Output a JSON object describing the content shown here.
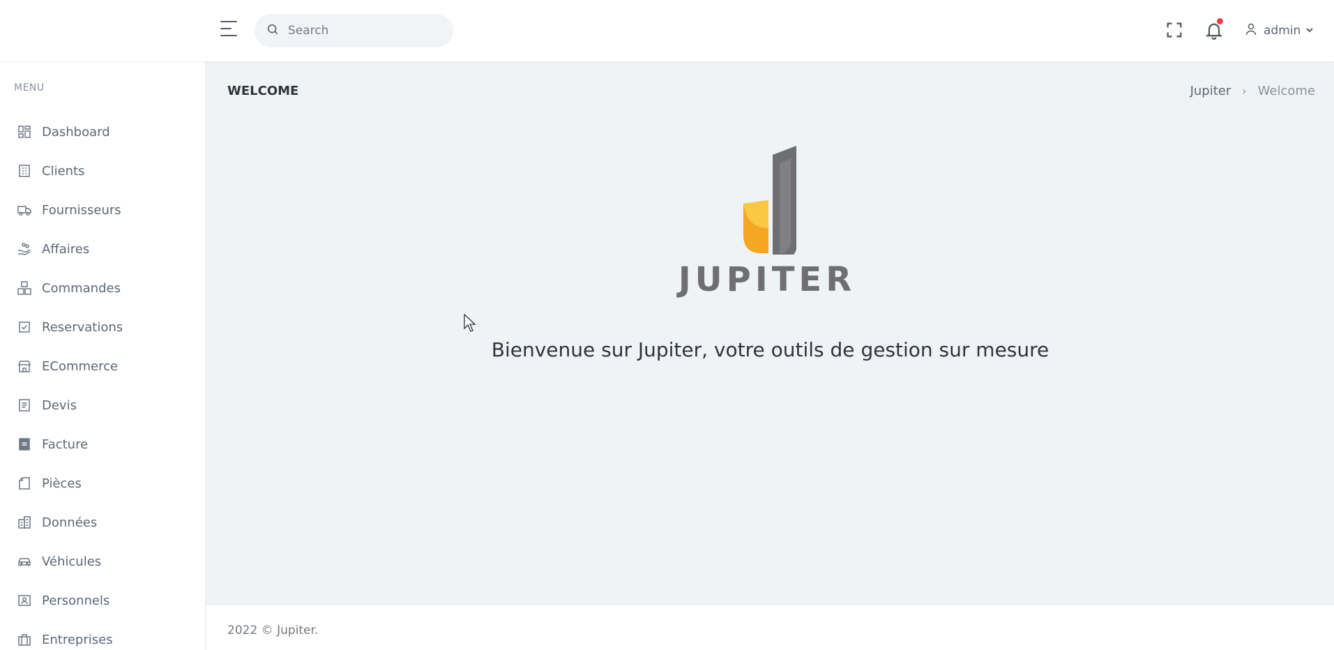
{
  "header": {
    "search_placeholder": "Search",
    "user_name": "admin"
  },
  "sidebar": {
    "menu_title": "MENU",
    "items": [
      {
        "label": "Dashboard",
        "icon": "dashboard-icon"
      },
      {
        "label": "Clients",
        "icon": "building-icon"
      },
      {
        "label": "Fournisseurs",
        "icon": "truck-icon"
      },
      {
        "label": "Affaires",
        "icon": "hand-coins-icon"
      },
      {
        "label": "Commandes",
        "icon": "boxes-icon"
      },
      {
        "label": "Reservations",
        "icon": "checkbox-icon"
      },
      {
        "label": "ECommerce",
        "icon": "store-icon"
      },
      {
        "label": "Devis",
        "icon": "document-icon"
      },
      {
        "label": "Facture",
        "icon": "invoice-icon"
      },
      {
        "label": "Pièces",
        "icon": "file-icon"
      },
      {
        "label": "Données",
        "icon": "database-building-icon"
      },
      {
        "label": "Véhicules",
        "icon": "car-icon"
      },
      {
        "label": "Personnels",
        "icon": "id-card-icon"
      },
      {
        "label": "Entreprises",
        "icon": "briefcase-icon"
      }
    ]
  },
  "page": {
    "title": "WELCOME",
    "breadcrumb": {
      "parent": "Jupiter",
      "current": "Welcome"
    },
    "logo_text": "JUPITER",
    "welcome_message": "Bienvenue sur Jupiter, votre outils de gestion sur mesure"
  },
  "footer": {
    "text": "2022 © Jupiter."
  },
  "colors": {
    "notification_dot": "#ef3b4d",
    "logo_yellow": "#fbc844",
    "logo_orange": "#f5a623",
    "logo_grey": "#6f6f73",
    "background": "#eff3f6"
  }
}
